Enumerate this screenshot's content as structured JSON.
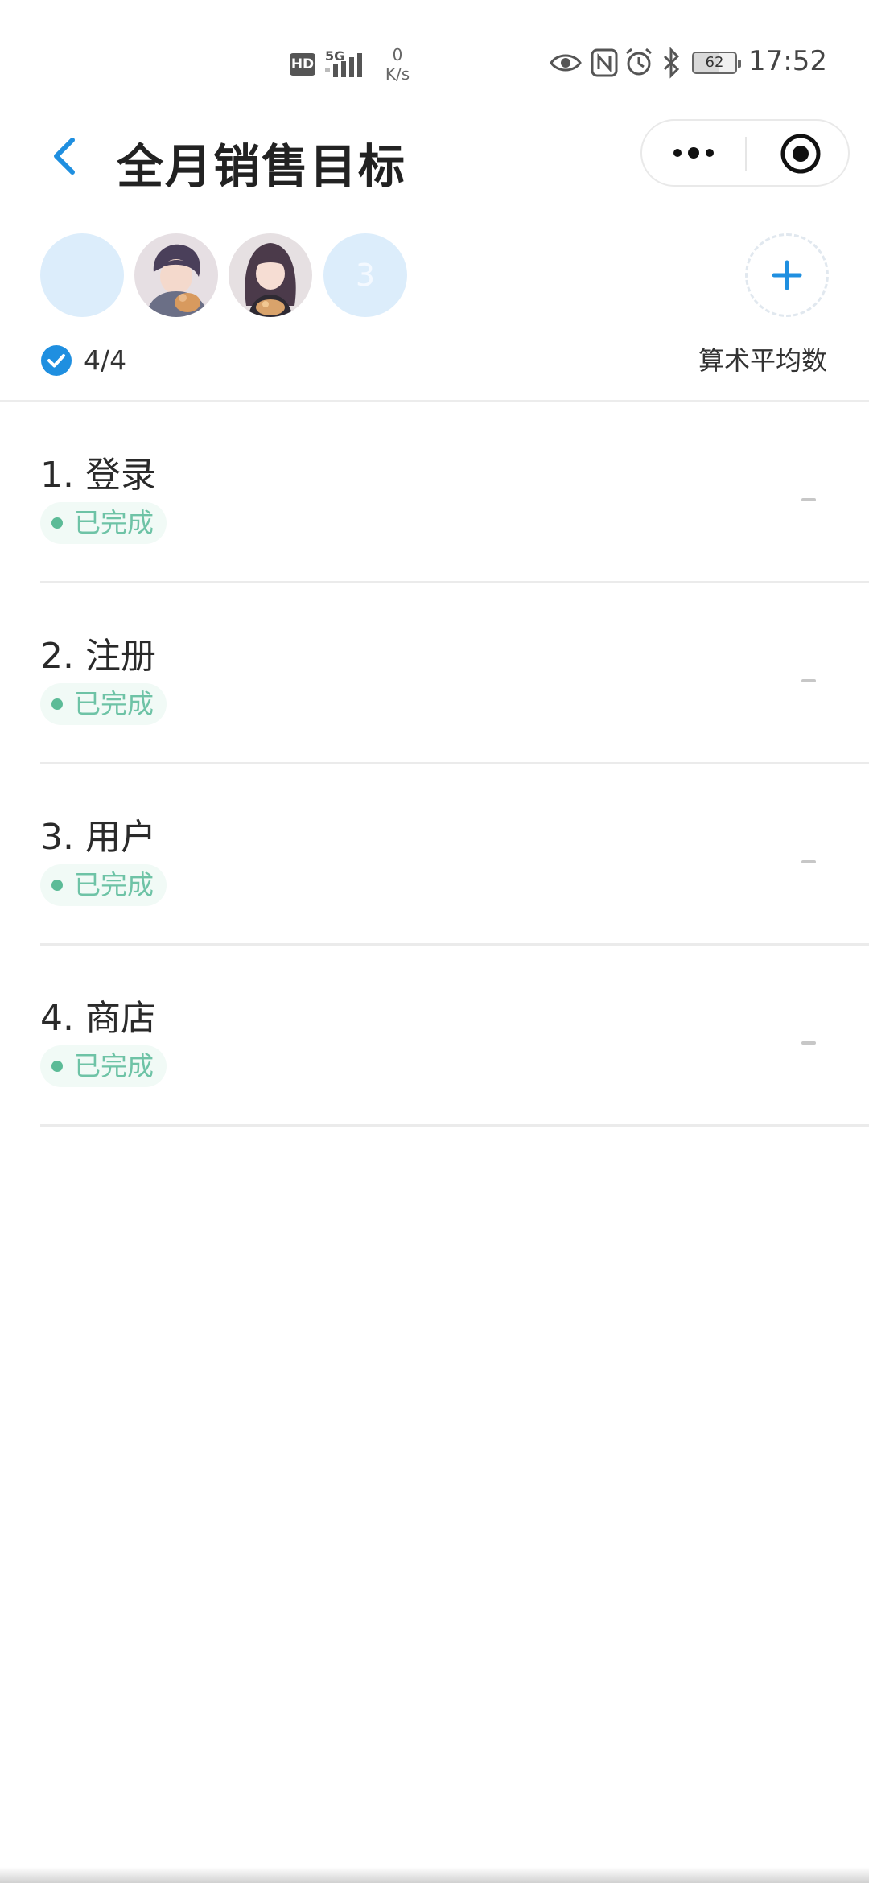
{
  "status_bar": {
    "hd": "HD",
    "network": "5G",
    "speed_value": "0",
    "speed_unit": "K/s",
    "battery": "62",
    "battery_level": 0.62,
    "time": "17:52",
    "icons": [
      "signal-icon",
      "eye-icon",
      "nfc-icon",
      "alarm-icon",
      "bluetooth-icon",
      "battery-icon"
    ]
  },
  "nav": {
    "title": "全月销售目标",
    "icons": [
      "back-icon",
      "more-icon",
      "close-miniprogram-icon"
    ]
  },
  "members": {
    "count_badge": "3",
    "avatars": [
      "empty-avatar",
      "boy-avatar",
      "girl-avatar",
      "count-avatar"
    ]
  },
  "summary": {
    "progress": "4/4",
    "mode": "算术平均数"
  },
  "tasks": [
    {
      "title": "1. 登录",
      "status": "已完成",
      "value": "-"
    },
    {
      "title": "2. 注册",
      "status": "已完成",
      "value": "-"
    },
    {
      "title": "3. 用户",
      "status": "已完成",
      "value": "-"
    },
    {
      "title": "4. 商店",
      "status": "已完成",
      "value": "-"
    }
  ],
  "colors": {
    "accent": "#1f8fe0",
    "done": "#6ec3a6",
    "avatar_bg": "#dcedfb"
  }
}
